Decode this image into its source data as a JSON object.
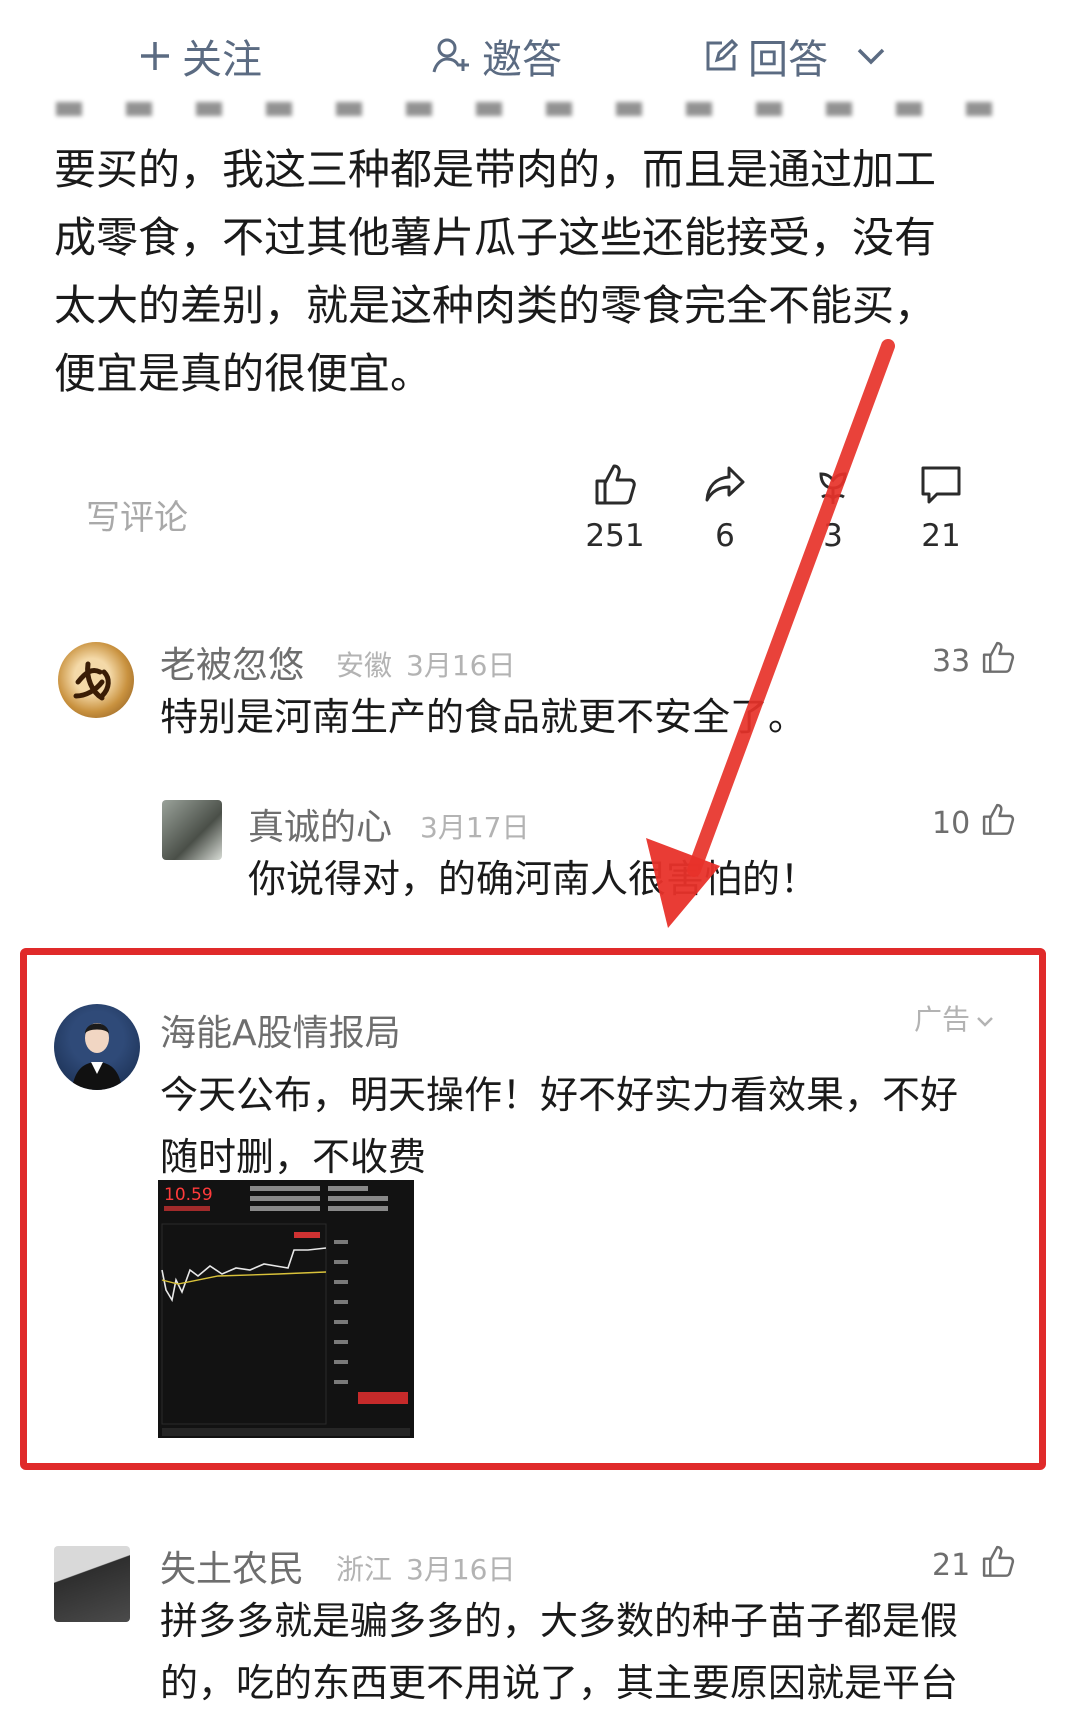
{
  "topbar": {
    "follow": "关注",
    "invite": "邀答",
    "answer": "回答"
  },
  "answer": {
    "paragraphs": [
      "要买的，我这三种都是带肉的，而且是通过加工",
      "成零食，不过其他薯片瓜子这些还能接受，没有",
      "太大的差别，就是这种肉类的零食完全不能买，",
      "便宜是真的很便宜。"
    ]
  },
  "actions": {
    "write_comment": "写评论",
    "like_count": "251",
    "share_count": "6",
    "favorite_count": "3",
    "comment_count": "21"
  },
  "comments": [
    {
      "name": "老被忽悠",
      "location": "安徽",
      "date": "3月16日",
      "text": "特别是河南生产的食品就更不安全了。",
      "likes": "33"
    },
    {
      "name": "真诚的心",
      "location": "",
      "date": "3月17日",
      "text": "你说得对，的确河南人很害怕的！",
      "likes": "10"
    },
    {
      "name": "失土农民",
      "location": "浙江",
      "date": "3月16日",
      "text_lines": [
        "拼多多就是骗多多的，大多数的种子苗子都是假",
        "的，吃的东西更不用说了，其主要原因就是平台"
      ],
      "likes": "21"
    }
  ],
  "ad": {
    "name": "海能A股情报局",
    "tag": "广告",
    "text_lines": [
      "今天公布，明天操作！好不好实力看效果，不好",
      "随时删，不收费"
    ],
    "chart_price": "10.59"
  },
  "colors": {
    "accent_red": "#e02a2a",
    "topbar_blue": "#5b6b82"
  }
}
